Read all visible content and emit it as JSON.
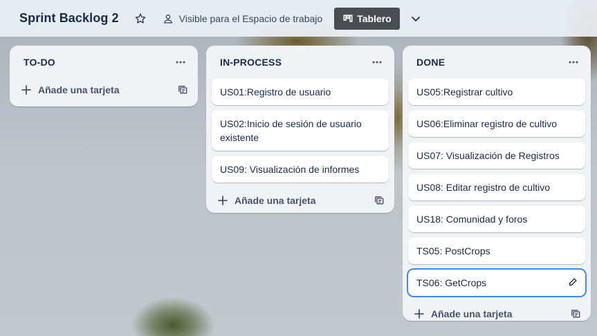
{
  "header": {
    "title": "Sprint Backlog 2",
    "visibility_label": "Visible para el Espacio de trabajo",
    "view_label": "Tablero"
  },
  "lists": [
    {
      "title": "TO-DO",
      "cards": [],
      "add_label": "Añade una tarjeta"
    },
    {
      "title": "IN-PROCESS",
      "cards": [
        "US01:Registro de usuario",
        "US02:Inicio de sesión de usuario existente",
        "US09: Visualización de informes"
      ],
      "add_label": "Añade una tarjeta"
    },
    {
      "title": "DONE",
      "cards": [
        "US05:Registrar cultivo",
        "US06:Eliminar registro de cultivo",
        "US07: Visualización de Registros",
        "US08: Editar registro de cultivo",
        "US18: Comunidad y foros",
        "TS05: PostCrops",
        "TS06: GetCrops"
      ],
      "add_label": "Añade una tarjeta"
    }
  ],
  "colors": {
    "view_button_bg": "#4a4d52",
    "active_card_border": "#388bff",
    "list_bg": "#f1f2f4"
  }
}
